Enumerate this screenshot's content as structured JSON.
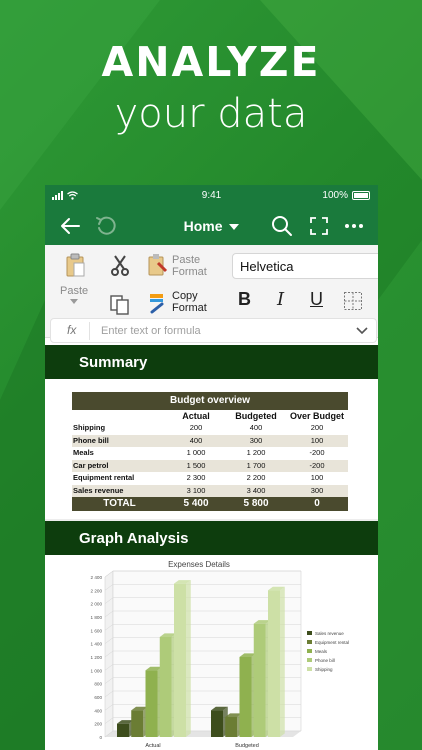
{
  "hero": {
    "title": "ANALYZE",
    "subtitle": "your data"
  },
  "status": {
    "time": "9:41",
    "battery": "100%"
  },
  "appbar": {
    "title": "Home"
  },
  "ribbon": {
    "paste_label": "Paste",
    "paste_format": [
      "Paste",
      "Format"
    ],
    "copy_format": [
      "Copy",
      "Format"
    ],
    "font": "Helvetica",
    "bold": "B",
    "italic": "I",
    "underline": "U"
  },
  "formula": {
    "fx": "fx",
    "placeholder": "Enter text or formula"
  },
  "summary": {
    "band": "Summary"
  },
  "budget": {
    "title": "Budget overview",
    "headers": [
      "",
      "Actual",
      "Budgeted",
      "Over Budget"
    ],
    "rows": [
      [
        "Shipping",
        "200",
        "400",
        "200"
      ],
      [
        "Phone bill",
        "400",
        "300",
        "100"
      ],
      [
        "Meals",
        "1 000",
        "1 200",
        "-200"
      ],
      [
        "Car petrol",
        "1 500",
        "1 700",
        "-200"
      ],
      [
        "Equipment rental",
        "2 300",
        "2 200",
        "100"
      ],
      [
        "Sales revenue",
        "3 100",
        "3 400",
        "300"
      ]
    ],
    "total": [
      "TOTAL",
      "5 400",
      "5 800",
      "0"
    ]
  },
  "graph": {
    "band": "Graph Analysis"
  },
  "chart_data": {
    "type": "bar",
    "title": "Expenses Details",
    "categories": [
      "Actual",
      "Budgeted"
    ],
    "ylim": [
      0,
      2400
    ],
    "yticks": [
      "0",
      "200",
      "400",
      "600",
      "800",
      "1 000",
      "1 200",
      "1 400",
      "1 600",
      "1 800",
      "2 000",
      "2 200",
      "2 400"
    ],
    "series": [
      {
        "name": "Sales revenue",
        "values": [
          200,
          400
        ],
        "color": "#3d4d1c"
      },
      {
        "name": "Equipment rental",
        "values": [
          400,
          300
        ],
        "color": "#6b7d34"
      },
      {
        "name": "Meals",
        "values": [
          1000,
          1200
        ],
        "color": "#8fb14f"
      },
      {
        "name": "Phone bill",
        "values": [
          1500,
          1700
        ],
        "color": "#aecb79"
      },
      {
        "name": "Shipping",
        "values": [
          2300,
          2200
        ],
        "color": "#cde0a6"
      }
    ],
    "legend": "right"
  },
  "colors": {
    "brand": "#1a7a3c",
    "band": "#0d3d0d",
    "table_head": "#4a4a2e"
  }
}
